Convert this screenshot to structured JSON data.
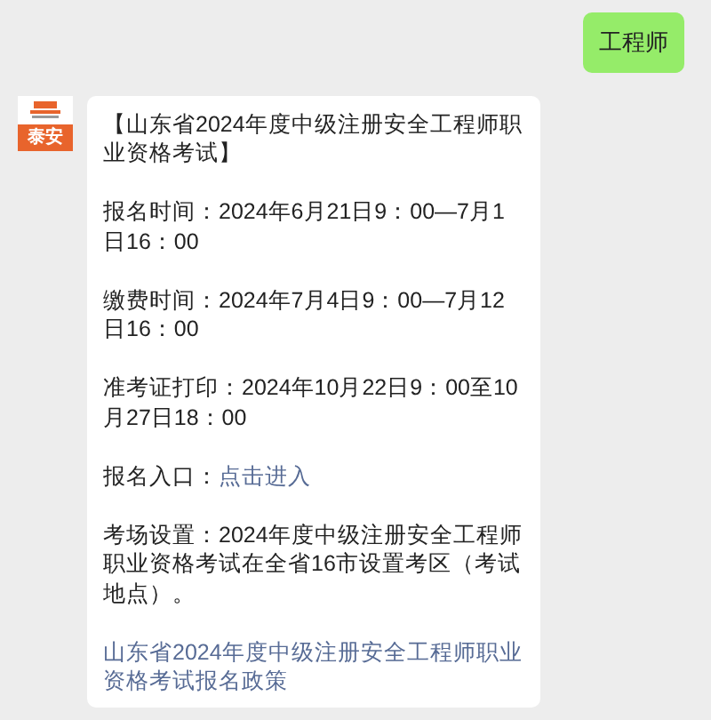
{
  "messages": [
    {
      "kind": "sent",
      "text": "工程师"
    },
    {
      "kind": "received",
      "avatar_label": "泰安",
      "paragraphs": [
        {
          "kind": "text",
          "text": "【山东省2024年度中级注册安全工程师职业资格考试】"
        },
        {
          "kind": "text",
          "text": "报名时间：2024年6月21日9：00—7月1日16：00"
        },
        {
          "kind": "text",
          "text": "缴费时间：2024年7月4日9：00—7月12日16：00"
        },
        {
          "kind": "text",
          "text": "准考证打印：2024年10月22日9：00至10月27日18：00"
        },
        {
          "kind": "text_link",
          "text": "报名入口：",
          "link": "点击进入"
        },
        {
          "kind": "text",
          "text": "考场设置：2024年度中级注册安全工程师职业资格考试在全省16市设置考区（考试地点）。"
        },
        {
          "kind": "link",
          "link": "山东省2024年度中级注册安全工程师职业资格考试报名政策"
        }
      ]
    }
  ]
}
